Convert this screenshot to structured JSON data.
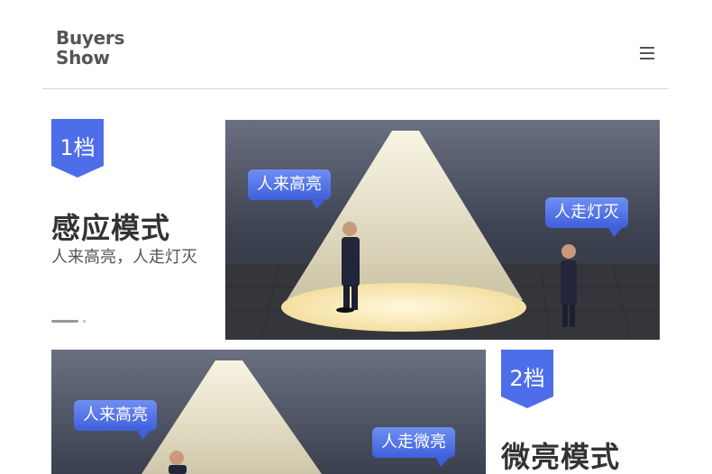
{
  "header": {
    "brand_line1": "Buyers",
    "brand_line2": "Show"
  },
  "modes": [
    {
      "badge": "1档",
      "title": "感应模式",
      "subtitle": "人来高亮，人走灯灭",
      "tag_near": "人来高亮",
      "tag_far": "人走灯灭"
    },
    {
      "badge": "2档",
      "title": "微亮模式",
      "tag_near": "人来高亮",
      "tag_far": "人走微亮"
    }
  ],
  "colors": {
    "accent": "#4a6ae6",
    "badge": "#4d6ee8",
    "scene_wall": "#3b4252",
    "scene_floor": "#2f3238",
    "light": "#fff5d6"
  }
}
